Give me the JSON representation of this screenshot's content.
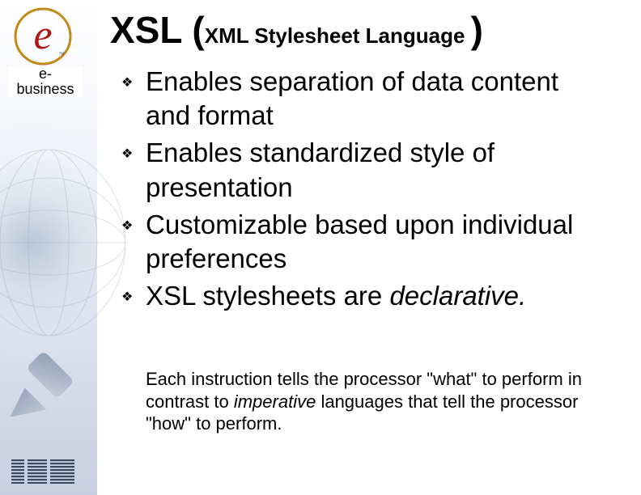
{
  "brand": {
    "ebusiness_caption_line1": "e-",
    "ebusiness_caption_line2": "business",
    "ibm_alt": "IBM"
  },
  "title": {
    "main": "XSL (",
    "sub": "XML Stylesheet Language ",
    "close": ")"
  },
  "bullets": [
    {
      "text": "Enables separation of data content and format"
    },
    {
      "text": "Enables standardized style of presentation"
    },
    {
      "text": "Customizable based upon individual preferences"
    },
    {
      "text_html": "XSL stylesheets are <em>declarative.</em>"
    }
  ],
  "subpara_html": "Each instruction tells the processor \"what\" to perform in contrast to <em>imperative</em> languages that tell the processor \"how\" to perform."
}
